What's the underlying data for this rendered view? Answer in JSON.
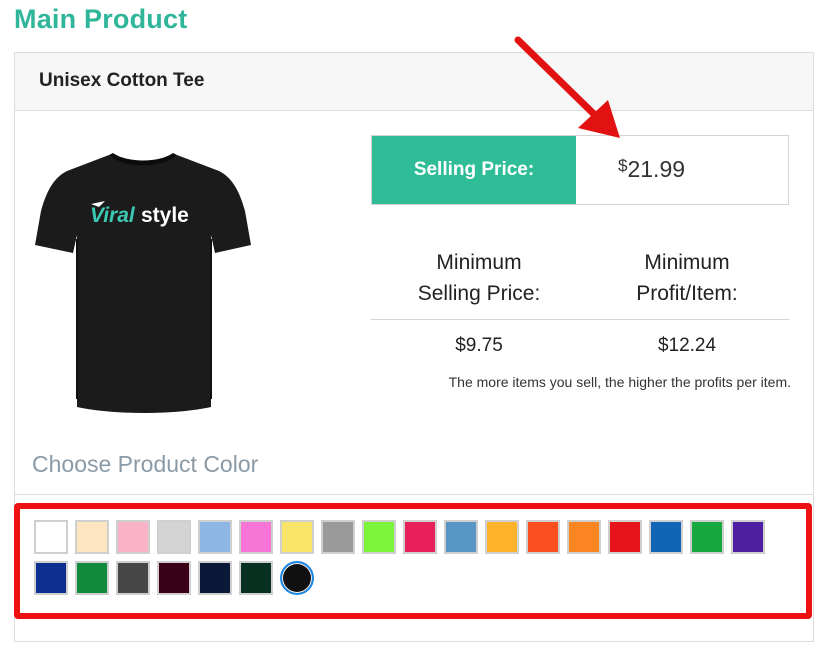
{
  "section": {
    "title": "Main Product"
  },
  "product": {
    "name": "Unisex Cotton Tee",
    "logo_text": "Viralstyle"
  },
  "pricing": {
    "selling_label": "Selling Price:",
    "currency_symbol": "$",
    "selling_value": "21.99",
    "min_price_label_line1": "Minimum",
    "min_price_label_line2": "Selling Price:",
    "min_profit_label_line1": "Minimum",
    "min_profit_label_line2": "Profit/Item:",
    "min_price_value": "$9.75",
    "min_profit_value": "$12.24",
    "note": "The more items you sell, the higher the profits per item."
  },
  "colors": {
    "heading": "Choose Product Color",
    "accent": "#2fbd97",
    "highlight": "#ee1111",
    "selected_index": 24,
    "swatches": [
      "#ffffff",
      "#fde6bf",
      "#f9b3c6",
      "#d4d4d4",
      "#8fb7e6",
      "#f875d8",
      "#f9e46a",
      "#9a9a9a",
      "#7cf43a",
      "#e8215d",
      "#5695c4",
      "#fcb32a",
      "#fb4f1f",
      "#fb8521",
      "#e8141c",
      "#1065b5",
      "#17a93f",
      "#4d1ea0",
      "#0d2f91",
      "#0f8b3b",
      "#474747",
      "#3a0018",
      "#0b1838",
      "#073020",
      "#111111"
    ]
  }
}
